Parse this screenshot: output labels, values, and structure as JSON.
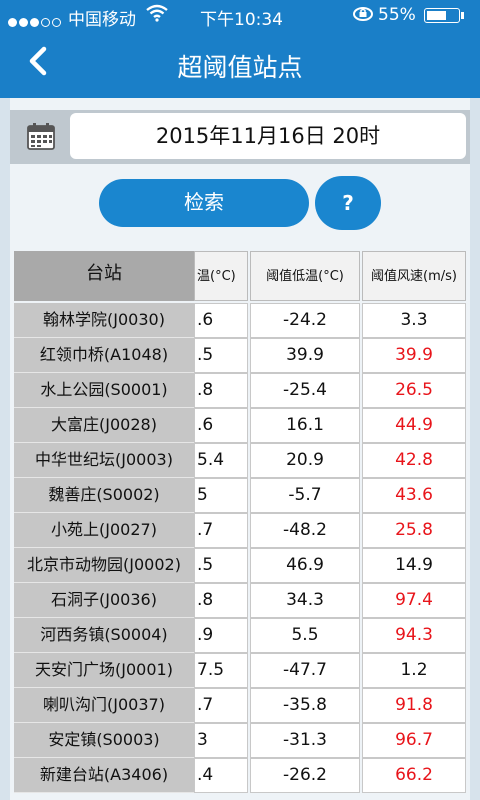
{
  "status": {
    "carrier": "中国移动",
    "time": "下午10:34",
    "battery": "55%",
    "battery_level": 0.55
  },
  "nav": {
    "back": "<",
    "title": "超阈值站点"
  },
  "date": {
    "value": "2015年11月16日 20时"
  },
  "buttons": {
    "search": "检索",
    "help": "?"
  },
  "table": {
    "headers": {
      "station": "台站",
      "high": "温(°C)",
      "low": "阈值低温(°C)",
      "wind": "阈值风速(m/s)"
    },
    "rows": [
      {
        "station": "翰林学院(J0030)",
        "high": ".6",
        "low": "-24.2",
        "wind": "3.3",
        "wind_red": false
      },
      {
        "station": "红领巾桥(A1048)",
        "high": ".5",
        "low": "39.9",
        "wind": "39.9",
        "wind_red": true
      },
      {
        "station": "水上公园(S0001)",
        "high": ".8",
        "low": "-25.4",
        "wind": "26.5",
        "wind_red": true
      },
      {
        "station": "大富庄(J0028)",
        "high": ".6",
        "low": "16.1",
        "wind": "44.9",
        "wind_red": true
      },
      {
        "station": "中华世纪坛(J0003)",
        "high": "5.4",
        "low": "20.9",
        "wind": "42.8",
        "wind_red": true
      },
      {
        "station": "魏善庄(S0002)",
        "high": "5",
        "low": "-5.7",
        "wind": "43.6",
        "wind_red": true
      },
      {
        "station": "小苑上(J0027)",
        "high": ".7",
        "low": "-48.2",
        "wind": "25.8",
        "wind_red": true
      },
      {
        "station": "北京市动物园(J0002)",
        "high": ".5",
        "low": "46.9",
        "wind": "14.9",
        "wind_red": false
      },
      {
        "station": "石洞子(J0036)",
        "high": ".8",
        "low": "34.3",
        "wind": "97.4",
        "wind_red": true
      },
      {
        "station": "河西务镇(S0004)",
        "high": ".9",
        "low": "5.5",
        "wind": "94.3",
        "wind_red": true
      },
      {
        "station": "天安门广场(J0001)",
        "high": "7.5",
        "low": "-47.7",
        "wind": "1.2",
        "wind_red": false
      },
      {
        "station": "喇叭沟门(J0037)",
        "high": ".7",
        "low": "-35.8",
        "wind": "91.8",
        "wind_red": true
      },
      {
        "station": "安定镇(S0003)",
        "high": "3",
        "low": "-31.3",
        "wind": "96.7",
        "wind_red": true
      },
      {
        "station": "新建台站(A3406)",
        "high": ".4",
        "low": "-26.2",
        "wind": "66.2",
        "wind_red": true
      }
    ]
  },
  "icons": {
    "wifi": "wifi-icon",
    "calendar": "calendar-icon",
    "lock": "rotation-lock-icon"
  },
  "colors": {
    "primary": "#1a7fc8",
    "warning": "#e8141a"
  }
}
